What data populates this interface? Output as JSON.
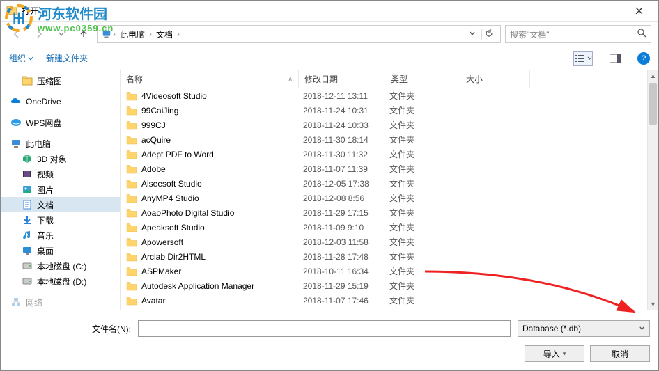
{
  "title": "打开",
  "breadcrumb": {
    "root_icon": "pc",
    "seg1": "此电脑",
    "seg2": "文档"
  },
  "search": {
    "placeholder": "搜索\"文档\""
  },
  "toolbar": {
    "organize": "组织",
    "newfolder": "新建文件夹"
  },
  "columns": {
    "name": "名称",
    "date": "修改日期",
    "type": "类型",
    "size": "大小"
  },
  "sidebar": [
    {
      "label": "压缩图",
      "icon": "folder",
      "level": 2
    },
    {
      "label": "OneDrive",
      "icon": "onedrive",
      "level": 1,
      "gapTop": true
    },
    {
      "label": "WPS网盘",
      "icon": "wps",
      "level": 1,
      "gapTop": true
    },
    {
      "label": "此电脑",
      "icon": "pc",
      "level": 1,
      "gapTop": true
    },
    {
      "label": "3D 对象",
      "icon": "3d",
      "level": 2
    },
    {
      "label": "视频",
      "icon": "video",
      "level": 2
    },
    {
      "label": "图片",
      "icon": "pics",
      "level": 2
    },
    {
      "label": "文档",
      "icon": "docs",
      "level": 2,
      "selected": true
    },
    {
      "label": "下载",
      "icon": "download",
      "level": 2
    },
    {
      "label": "音乐",
      "icon": "music",
      "level": 2
    },
    {
      "label": "桌面",
      "icon": "desktop",
      "level": 2
    },
    {
      "label": "本地磁盘 (C:)",
      "icon": "disk",
      "level": 2
    },
    {
      "label": "本地磁盘 (D:)",
      "icon": "disk",
      "level": 2
    },
    {
      "label": "网络",
      "icon": "network",
      "level": 1,
      "gapTop": true,
      "cut": true
    }
  ],
  "files": [
    {
      "name": "4Videosoft Studio",
      "date": "2018-12-11 13:11",
      "type": "文件夹"
    },
    {
      "name": "99CaiJing",
      "date": "2018-11-24 10:31",
      "type": "文件夹"
    },
    {
      "name": "999CJ",
      "date": "2018-11-24 10:33",
      "type": "文件夹"
    },
    {
      "name": "acQuire",
      "date": "2018-11-30 18:14",
      "type": "文件夹"
    },
    {
      "name": "Adept PDF to Word",
      "date": "2018-11-30 11:32",
      "type": "文件夹"
    },
    {
      "name": "Adobe",
      "date": "2018-11-07 11:39",
      "type": "文件夹"
    },
    {
      "name": "Aiseesoft Studio",
      "date": "2018-12-05 17:38",
      "type": "文件夹"
    },
    {
      "name": "AnyMP4 Studio",
      "date": "2018-12-08 8:56",
      "type": "文件夹"
    },
    {
      "name": "AoaoPhoto Digital Studio",
      "date": "2018-11-29 17:15",
      "type": "文件夹"
    },
    {
      "name": "Apeaksoft Studio",
      "date": "2018-11-09 9:10",
      "type": "文件夹"
    },
    {
      "name": "Apowersoft",
      "date": "2018-12-03 11:58",
      "type": "文件夹"
    },
    {
      "name": "Arclab Dir2HTML",
      "date": "2018-11-28 17:48",
      "type": "文件夹"
    },
    {
      "name": "ASPMaker",
      "date": "2018-10-11 16:34",
      "type": "文件夹"
    },
    {
      "name": "Autodesk Application Manager",
      "date": "2018-11-29 15:19",
      "type": "文件夹"
    },
    {
      "name": "Avatar",
      "date": "2018-11-07 17:46",
      "type": "文件夹"
    }
  ],
  "filename_label": "文件名(N):",
  "filename_value": "",
  "filetype": "Database (*.db)",
  "buttons": {
    "open": "导入",
    "cancel": "取消"
  },
  "watermark": {
    "line1": "河东软件园",
    "line2": "www.pc0359.cn"
  }
}
